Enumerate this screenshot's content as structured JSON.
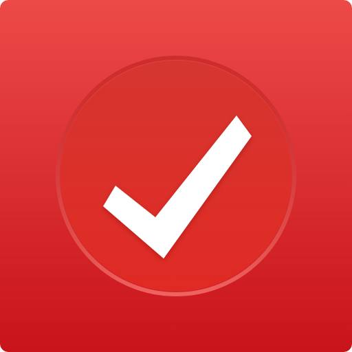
{
  "icon": {
    "name": "checkmark-app-icon",
    "glyph": "check-icon",
    "colors": {
      "background_top": "#ec4a48",
      "background_bottom": "#c8141a",
      "circle_fill_top": "#d63630",
      "circle_fill_bottom": "#e02a24",
      "circle_ring": "#f26a66",
      "check": "#ffffff"
    }
  }
}
